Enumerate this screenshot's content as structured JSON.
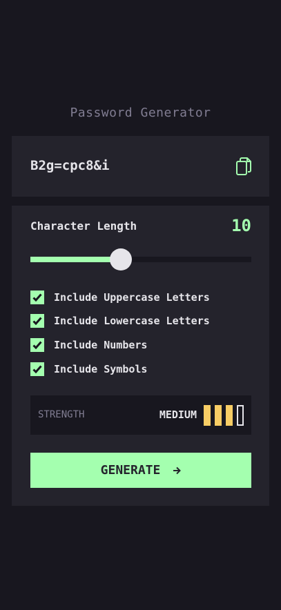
{
  "app": {
    "title": "Password Generator"
  },
  "output": {
    "password": "B2g=cpc8&i",
    "copy_icon": "copy-icon"
  },
  "settings": {
    "length_label": "Character Length",
    "length_value": "10",
    "slider": {
      "min": 0,
      "max": 20,
      "value": 10
    },
    "options": [
      {
        "label": "Include Uppercase Letters",
        "checked": true
      },
      {
        "label": "Include Lowercase Letters",
        "checked": true
      },
      {
        "label": "Include Numbers",
        "checked": true
      },
      {
        "label": "Include Symbols",
        "checked": true
      }
    ],
    "strength": {
      "label": "STRENGTH",
      "value": "MEDIUM",
      "filled_bars": 3,
      "total_bars": 4
    },
    "generate_label": "GENERATE",
    "generate_icon": "arrow-right-icon"
  },
  "colors": {
    "accent": "#a4ffaf",
    "background": "#18171f",
    "panel": "#24232c",
    "muted": "#817d92",
    "text": "#e6e5ea",
    "strength_medium": "#f8cd65"
  }
}
